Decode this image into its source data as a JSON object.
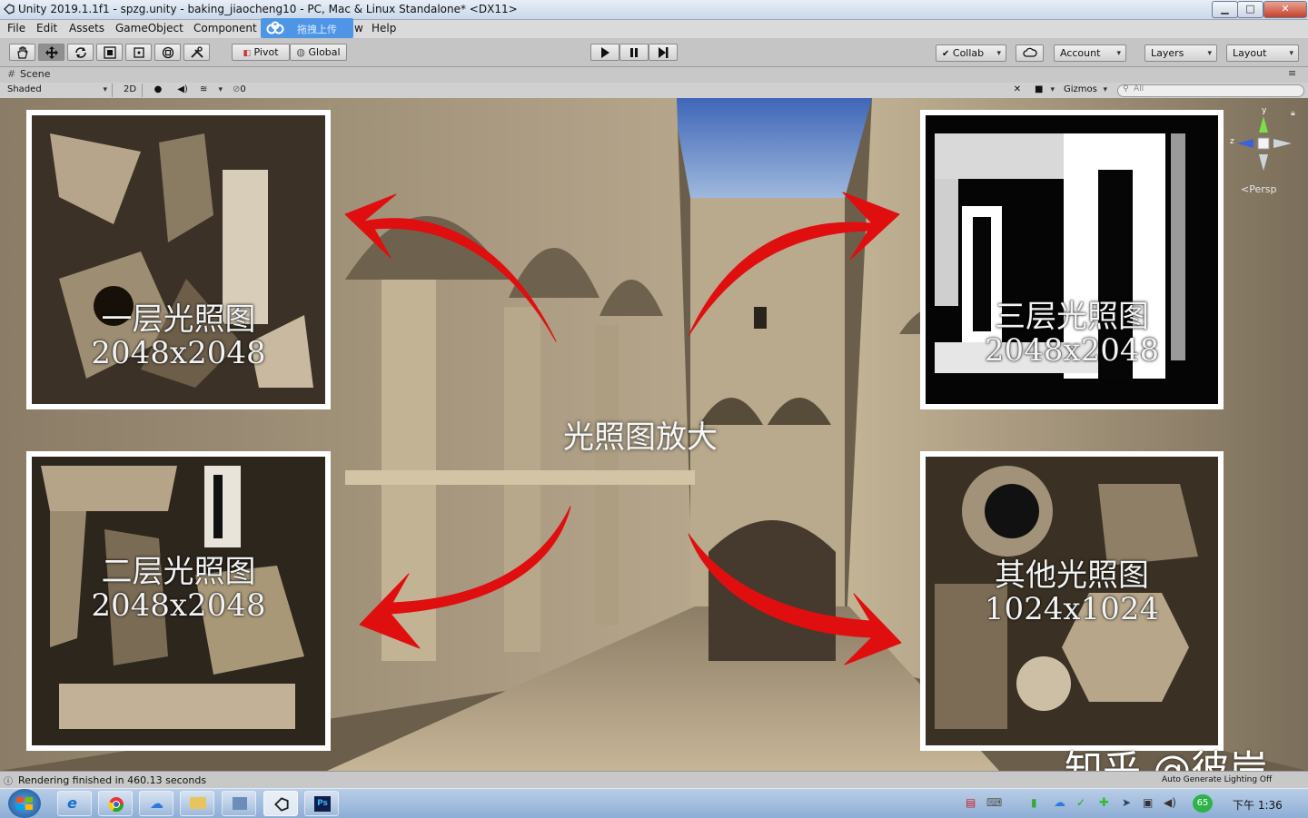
{
  "window": {
    "title": "Unity 2019.1.1f1 - spzg.unity - baking_jiaocheng10 - PC, Mac & Linux Standalone* <DX11>",
    "min": "▁",
    "max": "□",
    "close": "✕"
  },
  "menu": [
    "File",
    "Edit",
    "Assets",
    "GameObject",
    "Component",
    "w",
    "Help"
  ],
  "upload_badge": "拖拽上传",
  "toolbar": {
    "pivot": "Pivot",
    "global": "Global",
    "collab": "Collab",
    "account": "Account",
    "layers": "Layers",
    "layout": "Layout"
  },
  "scene": {
    "tab": "Scene",
    "shading": "Shaded",
    "mode_2d": "2D",
    "hidden_count": "0",
    "gizmos": "Gizmos",
    "search_placeholder": "All",
    "persp": "Persp",
    "axis_y": "y",
    "axis_z": "z"
  },
  "lightmaps": [
    {
      "label": "一层光照图",
      "size": "2048x2048"
    },
    {
      "label": "三层光照图",
      "size": "2048x2048"
    },
    {
      "label": "二层光照图",
      "size": "2048x2048"
    },
    {
      "label": "其他光照图",
      "size": "1024x1024"
    }
  ],
  "center_label": "光照图放大",
  "watermark": "知乎 @彼岸",
  "status": {
    "message": "Rendering finished in 460.13 seconds",
    "auto_lighting": "Auto Generate Lighting Off"
  },
  "taskbar": {
    "badge": "65",
    "clock": "下午 1:36"
  },
  "colors": {
    "arrow": "#e00f0f",
    "frame": "#ffffff",
    "upload": "#4f95e6"
  }
}
